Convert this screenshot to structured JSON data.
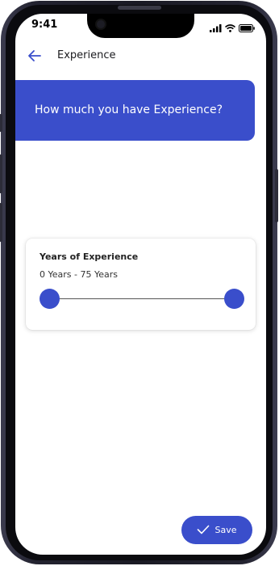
{
  "status_bar": {
    "time": "9:41"
  },
  "header": {
    "title": "Experience"
  },
  "banner": {
    "question": "How much you have Experience?"
  },
  "experience_card": {
    "title": "Years of Experience",
    "range_text": "0 Years - 75 Years",
    "slider": {
      "min_value": 0,
      "max_value": 75,
      "min_selected": 0,
      "max_selected": 75
    }
  },
  "actions": {
    "save_label": "Save"
  },
  "colors": {
    "accent": "#3a4ecb",
    "background": "#ffffff",
    "frame": "#1a1a24"
  },
  "icons": [
    "back-arrow-icon",
    "signal-icon",
    "wifi-icon",
    "battery-icon",
    "checkmark-icon"
  ]
}
